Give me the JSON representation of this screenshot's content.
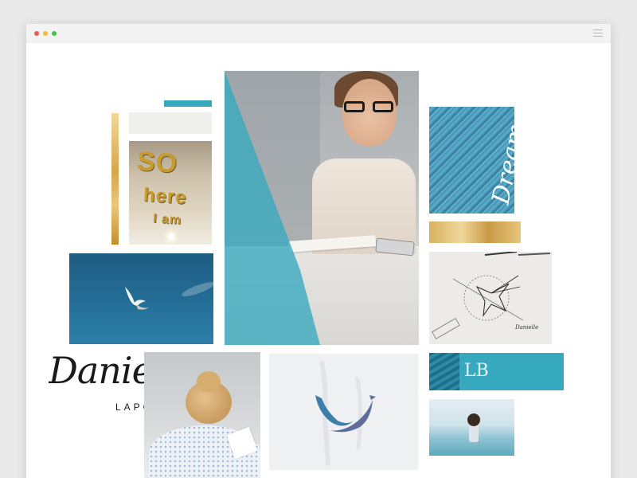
{
  "window": {
    "controls": [
      "close",
      "minimize",
      "maximize"
    ],
    "menu_icon": "hamburger-menu-icon"
  },
  "moodboard": {
    "sign_photo": {
      "words": [
        "SO",
        "here",
        "I am"
      ]
    },
    "leaf_photo": {
      "script_text": "Dream your"
    },
    "logo": {
      "script": "Danielle",
      "subtitle": "LAPORTE"
    },
    "sketch": {
      "signature": "Danielle"
    },
    "banner": {
      "monogram": "LB"
    }
  },
  "colors": {
    "accent_teal": "#36a9bf",
    "gold": "#d6a64c",
    "cream": "#efefeb",
    "sky_blue": "#246e97"
  }
}
